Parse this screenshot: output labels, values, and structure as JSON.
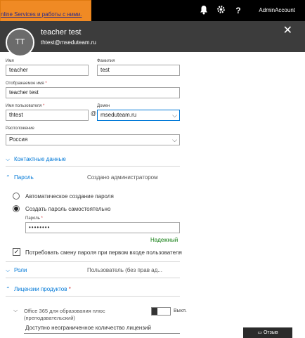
{
  "notice": {
    "text": "nline Services и работы с ними."
  },
  "topbar": {
    "bell_icon": "bell-icon",
    "gear_icon": "gear-icon",
    "help_label": "?",
    "account": "AdminAccount"
  },
  "user": {
    "initials": "TT",
    "name": "teacher test",
    "email": "thtest@mseduteam.ru",
    "close_label": "✕"
  },
  "form": {
    "first_name": {
      "label": "Имя",
      "value": "teacher"
    },
    "last_name": {
      "label": "Фамилия",
      "value": "test"
    },
    "display_name": {
      "label": "Отображаемое имя",
      "required": "*",
      "value": "teacher test"
    },
    "username": {
      "label": "Имя пользователя",
      "required": "*",
      "value": "thtest"
    },
    "at_symbol": "@",
    "domain": {
      "label": "Домен",
      "value": "mseduteam.ru"
    },
    "location": {
      "label": "Расположение",
      "value": "Россия"
    }
  },
  "sections": {
    "contacts": {
      "label": "Контактные данные",
      "expanded": false
    },
    "password": {
      "label": "Пароль",
      "note": "Создано администратором",
      "expanded": true,
      "option_auto": "Автоматическое создание пароля",
      "option_manual": "Создать пароль самостоятельно",
      "selected": "manual",
      "field_label": "Пароль",
      "required": "*",
      "value": "••••••••",
      "strength": "Надежный",
      "force_change_label": "Потребовать смену пароля при первом входе пользователя",
      "force_change_checked": true
    },
    "roles": {
      "label": "Роли",
      "note": "Пользователь (без прав ад...",
      "expanded": false
    },
    "licenses": {
      "label": "Лицензии продуктов",
      "required": "*",
      "expanded": true,
      "product": "Office 365 для образования плюс (преподавательский)",
      "toggle_label": "Выкл.",
      "toggle_on": false,
      "availability": "Доступно неограниченное количество лицензий"
    }
  },
  "feedback": {
    "label": "Отзыв"
  },
  "colors": {
    "accent": "#0078d7",
    "topbar": "#000000",
    "header": "#3c3c3c",
    "notice": "#f08a24",
    "strength": "#107c10"
  }
}
